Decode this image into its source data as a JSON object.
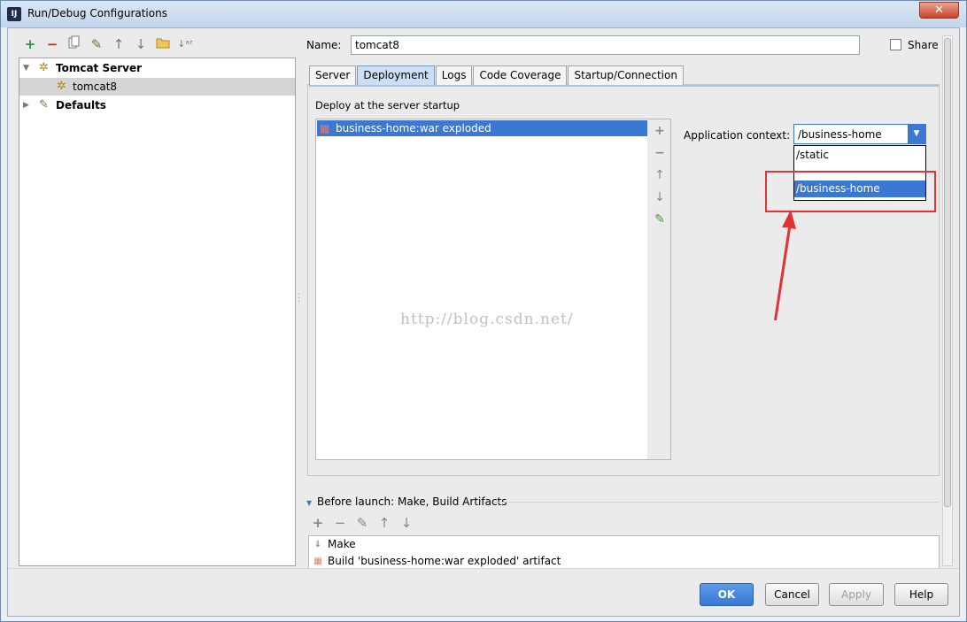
{
  "window": {
    "title": "Run/Debug Configurations",
    "close_glyph": "✕"
  },
  "toolbar_icons": [
    "plus-icon",
    "minus-icon",
    "copy-icon",
    "wrench-icon",
    "arrow-up-icon",
    "arrow-down-icon",
    "folder-icon",
    "sort-icon"
  ],
  "tree": {
    "items": [
      {
        "label": "Tomcat Server",
        "bold": true
      },
      {
        "label": "tomcat8",
        "bold": false
      },
      {
        "label": "Defaults",
        "bold": true
      }
    ]
  },
  "name": {
    "label": "Name:",
    "value": "tomcat8"
  },
  "share": {
    "label": "Share",
    "checked": false
  },
  "tabs": [
    {
      "label": "Server",
      "active": false
    },
    {
      "label": "Deployment",
      "active": true
    },
    {
      "label": "Logs",
      "active": false
    },
    {
      "label": "Code Coverage",
      "active": false
    },
    {
      "label": "Startup/Connection",
      "active": false
    }
  ],
  "deployment": {
    "section_label": "Deploy at the server startup",
    "items": [
      "business-home:war exploded"
    ],
    "context_label": "Application context:",
    "context_value": "/business-home",
    "dropdown_options": [
      "/static",
      "",
      "/business-home"
    ]
  },
  "watermark": "http://blog.csdn.net/",
  "before_launch": {
    "header": "Before launch: Make, Build Artifacts",
    "items": [
      "Make",
      "Build 'business-home:war exploded' artifact"
    ]
  },
  "buttons": {
    "ok": "OK",
    "cancel": "Cancel",
    "apply": "Apply",
    "help": "Help"
  },
  "colors": {
    "selection": "#3a78d4",
    "annotation": "#e63131"
  }
}
